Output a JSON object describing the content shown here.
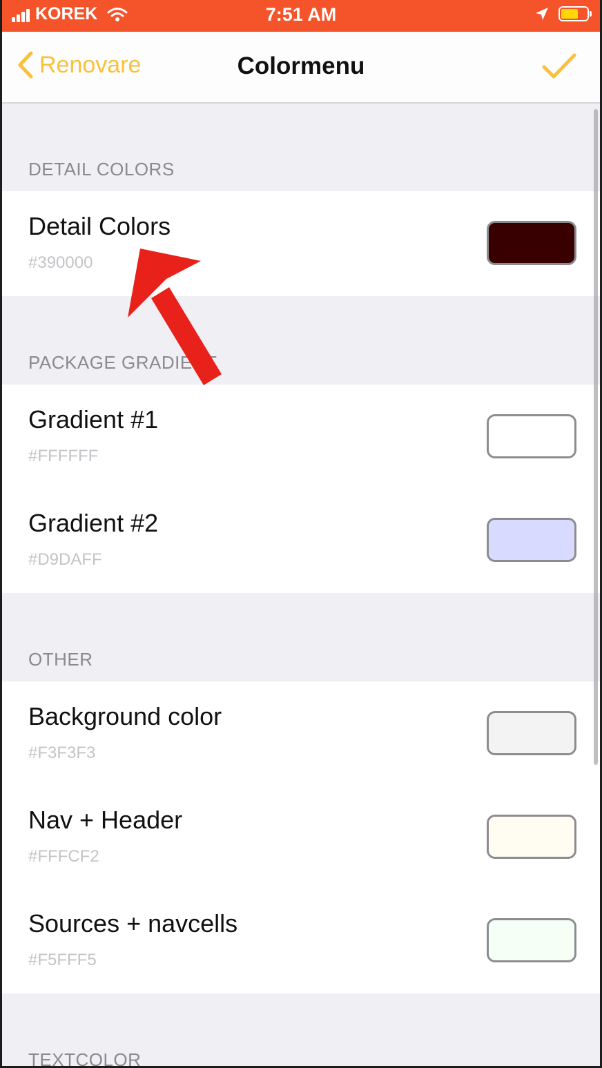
{
  "status_bar": {
    "carrier": "KOREK",
    "time": "7:51 AM",
    "color": "#f5542a"
  },
  "nav": {
    "back_label": "Renovare",
    "title": "Colormenu",
    "accent_color": "#f9c13a"
  },
  "sections": [
    {
      "header": "DETAIL COLORS",
      "cells": [
        {
          "title": "Detail Colors",
          "value": "#390000",
          "swatch": "#390000"
        }
      ]
    },
    {
      "header": "PACKAGE GRADIENT",
      "cells": [
        {
          "title": "Gradient #1",
          "value": "#FFFFFF",
          "swatch": "#FFFFFF"
        },
        {
          "title": "Gradient #2",
          "value": "#D9DAFF",
          "swatch": "#D9DAFF"
        }
      ]
    },
    {
      "header": "OTHER",
      "cells": [
        {
          "title": "Background color",
          "value": "#F3F3F3",
          "swatch": "#F3F3F3"
        },
        {
          "title": "Nav + Header",
          "value": "#FFFCF2",
          "swatch": "#FFFCF2"
        },
        {
          "title": "Sources + navcells",
          "value": "#F5FFF5",
          "swatch": "#F5FFF5"
        }
      ]
    },
    {
      "header": "TEXTCOLOR",
      "cells": []
    }
  ],
  "annotation_color": "#e8221b"
}
